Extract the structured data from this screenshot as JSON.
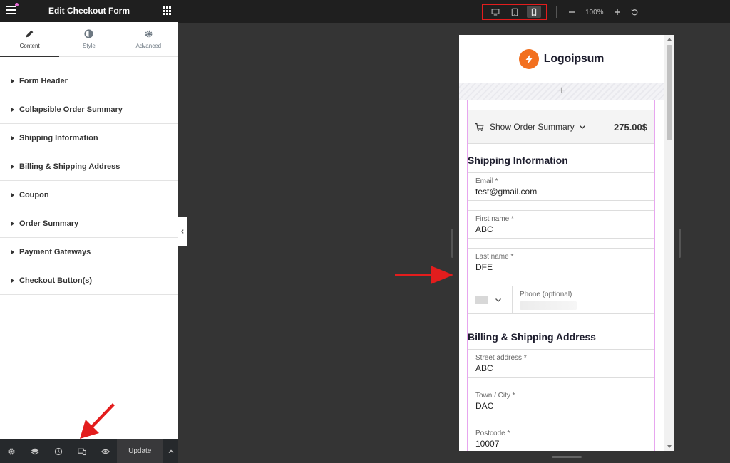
{
  "panel": {
    "title": "Edit Checkout Form",
    "tabs": [
      {
        "label": "Content",
        "icon": "pencil-icon"
      },
      {
        "label": "Style",
        "icon": "contrast-icon"
      },
      {
        "label": "Advanced",
        "icon": "gear-icon"
      }
    ],
    "sections": [
      "Form Header",
      "Collapsible Order Summary",
      "Shipping Information",
      "Billing & Shipping Address",
      "Coupon",
      "Order Summary",
      "Payment Gateways",
      "Checkout Button(s)"
    ],
    "footer": {
      "icons": [
        "settings-icon",
        "layers-icon",
        "history-icon",
        "responsive-mode-icon",
        "preview-eye-icon"
      ],
      "update_label": "Update"
    }
  },
  "topbar": {
    "devices": [
      "desktop-icon",
      "tablet-icon",
      "mobile-icon"
    ],
    "active_device": "mobile",
    "zoom": "100%"
  },
  "preview": {
    "brand": "Logoipsum",
    "order_summary": {
      "label": "Show Order Summary",
      "total": "275.00$"
    },
    "shipping_heading": "Shipping Information",
    "fields": {
      "email": {
        "label": "Email *",
        "value": "test@gmail.com"
      },
      "first_name": {
        "label": "First name *",
        "value": "ABC"
      },
      "last_name": {
        "label": "Last name *",
        "value": "DFE"
      },
      "phone": {
        "label": "Phone (optional)",
        "value": ""
      },
      "street": {
        "label": "Street address *",
        "value": "ABC"
      },
      "city": {
        "label": "Town / City *",
        "value": "DAC"
      },
      "postcode": {
        "label": "Postcode *",
        "value": "10007"
      }
    },
    "billing_heading": "Billing & Shipping Address"
  },
  "colors": {
    "annotation_red": "#e31d1d",
    "logo_orange": "#f2701f",
    "form_outline": "#e7a6ef"
  }
}
